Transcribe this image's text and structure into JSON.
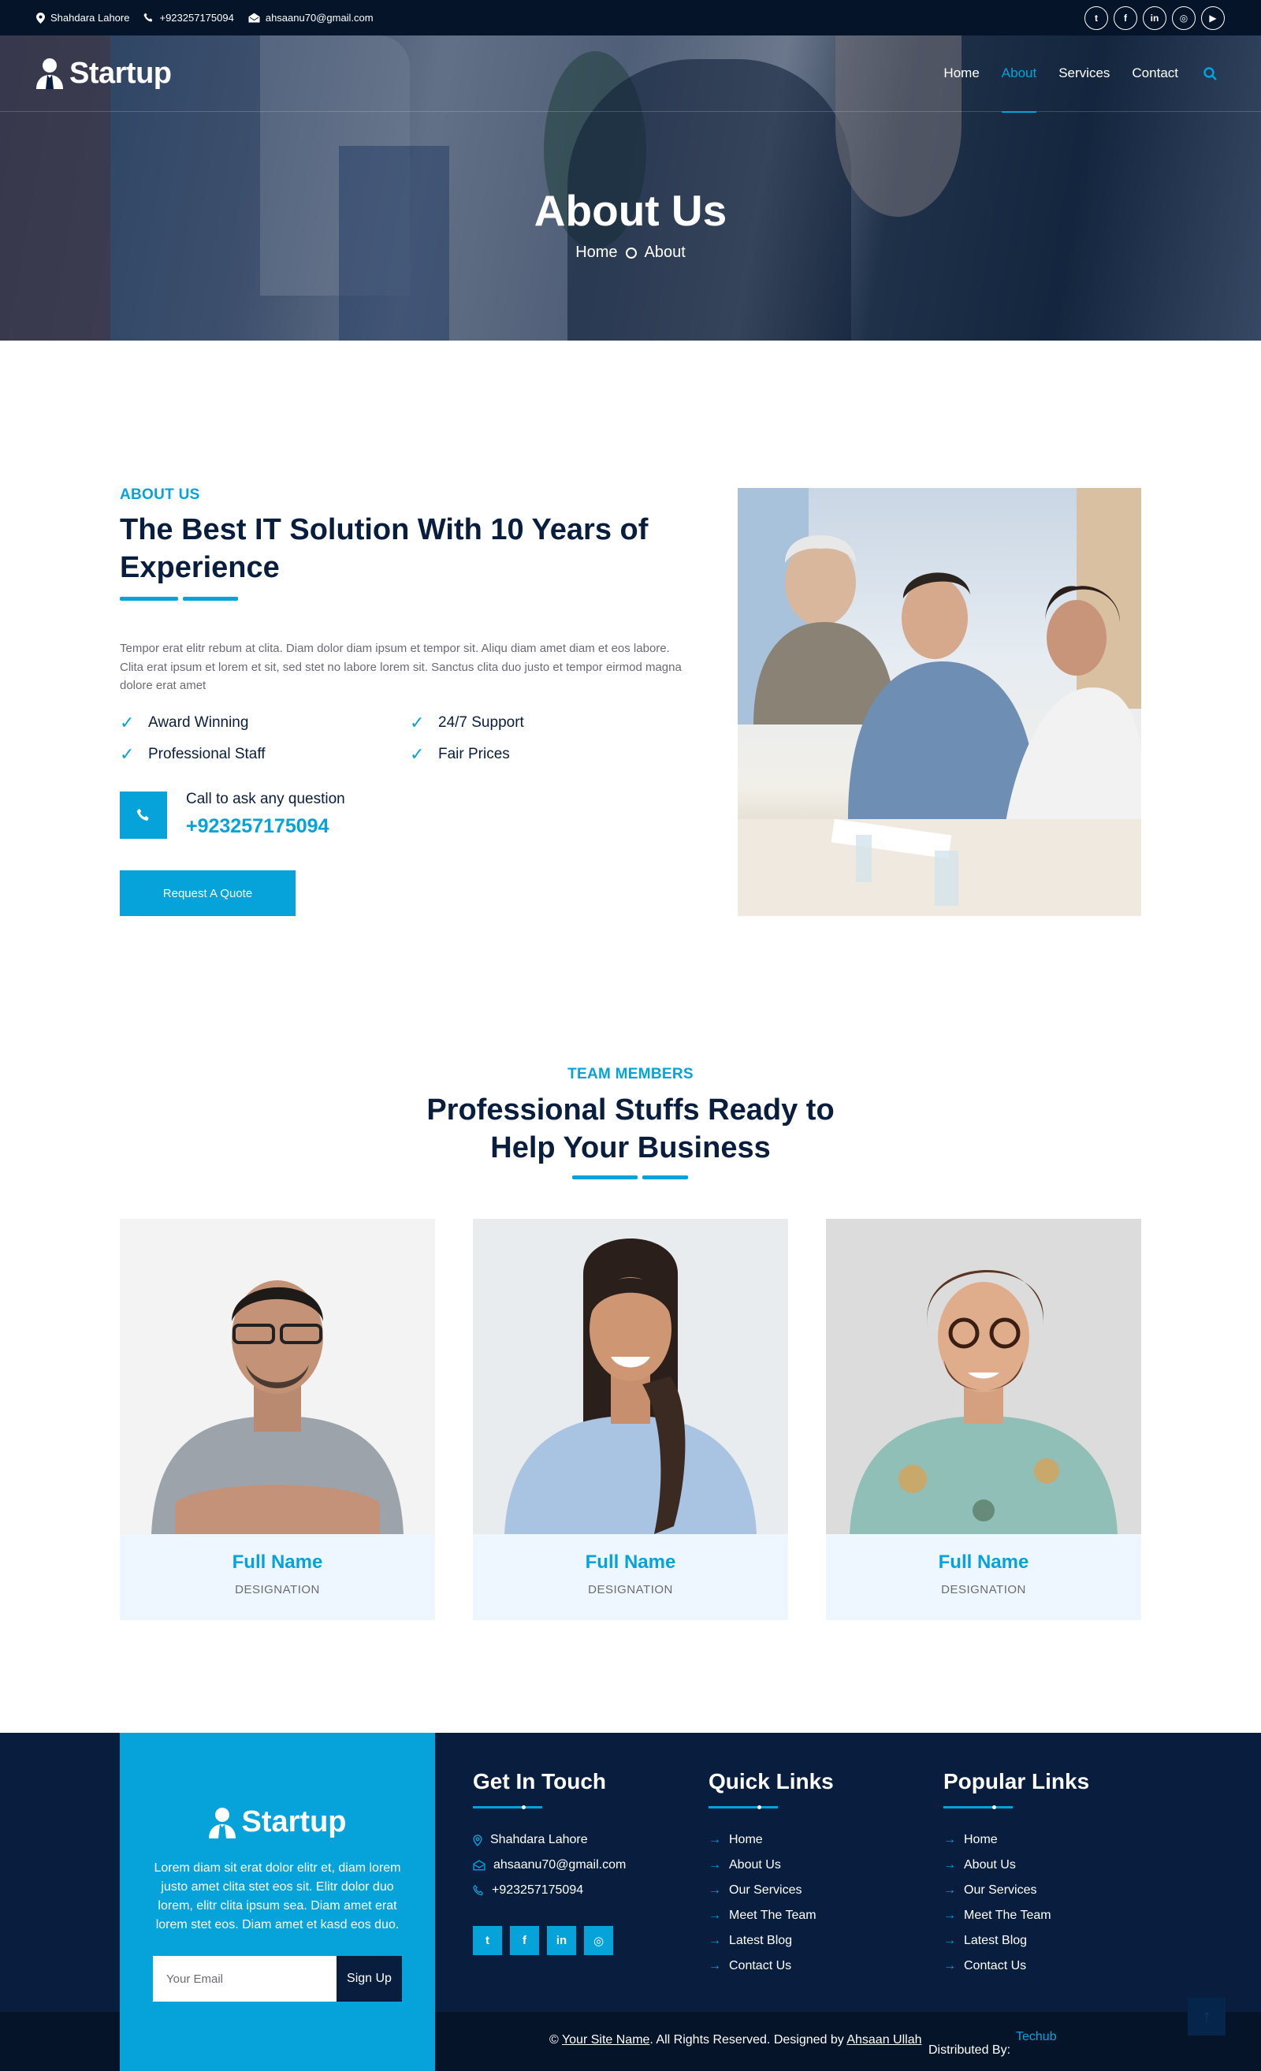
{
  "topbar": {
    "address": "Shahdara Lahore",
    "phone": "+923257175094",
    "email": "ahsaanu70@gmail.com",
    "social": [
      "twitter-icon",
      "facebook-icon",
      "linkedin-icon",
      "instagram-icon",
      "youtube-icon"
    ]
  },
  "brand": "Startup",
  "nav": {
    "items": [
      {
        "label": "Home"
      },
      {
        "label": "About",
        "active": true
      },
      {
        "label": "Services"
      },
      {
        "label": "Contact"
      }
    ]
  },
  "hero": {
    "title": "About Us",
    "crumb_home": "Home",
    "crumb_current": "About"
  },
  "about": {
    "subtitle": "ABOUT US",
    "title": "The Best IT Solution With 10 Years of Experience",
    "text": "Tempor erat elitr rebum at clita. Diam dolor diam ipsum et tempor sit. Aliqu diam amet diam et eos labore. Clita erat ipsum et lorem et sit, sed stet no labore lorem sit. Sanctus clita duo justo et tempor eirmod magna dolore erat amet",
    "features": [
      "Award Winning",
      "24/7 Support",
      "Professional Staff",
      "Fair Prices"
    ],
    "call_label": "Call to ask any question",
    "call_number": "+923257175094",
    "button": "Request A Quote"
  },
  "team": {
    "subtitle": "TEAM MEMBERS",
    "title_line1": "Professional Stuffs Ready to",
    "title_line2": "Help Your Business",
    "members": [
      {
        "name": "Full Name",
        "designation": "DESIGNATION"
      },
      {
        "name": "Full Name",
        "designation": "DESIGNATION"
      },
      {
        "name": "Full Name",
        "designation": "DESIGNATION"
      }
    ]
  },
  "footer": {
    "brand": "Startup",
    "about_text": "Lorem diam sit erat dolor elitr et, diam lorem justo amet clita stet eos sit. Elitr dolor duo lorem, elitr clita ipsum sea. Diam amet erat lorem stet eos. Diam amet et kasd eos duo.",
    "email_placeholder": "Your Email",
    "signup": "Sign Up",
    "get_in_touch": {
      "title": "Get In Touch",
      "address": "Shahdara Lahore",
      "email": "ahsaanu70@gmail.com",
      "phone": "+923257175094"
    },
    "quick_links": {
      "title": "Quick Links",
      "items": [
        "Home",
        "About Us",
        "Our Services",
        "Meet The Team",
        "Latest Blog",
        "Contact Us"
      ]
    },
    "popular_links": {
      "title": "Popular Links",
      "items": [
        "Home",
        "About Us",
        "Our Services",
        "Meet The Team",
        "Latest Blog",
        "Contact Us"
      ]
    },
    "copyright": {
      "prefix": "©",
      "site": "Your Site Name",
      "middle": ". All Rights Reserved. Designed by",
      "designer": "Ahsaan Ullah",
      "distributed": "Distributed By:",
      "distributor": "Techub"
    }
  },
  "colors": {
    "primary": "#06a3da",
    "dark": "#091e3e",
    "darker": "#061429",
    "light": "#eef7ff"
  }
}
